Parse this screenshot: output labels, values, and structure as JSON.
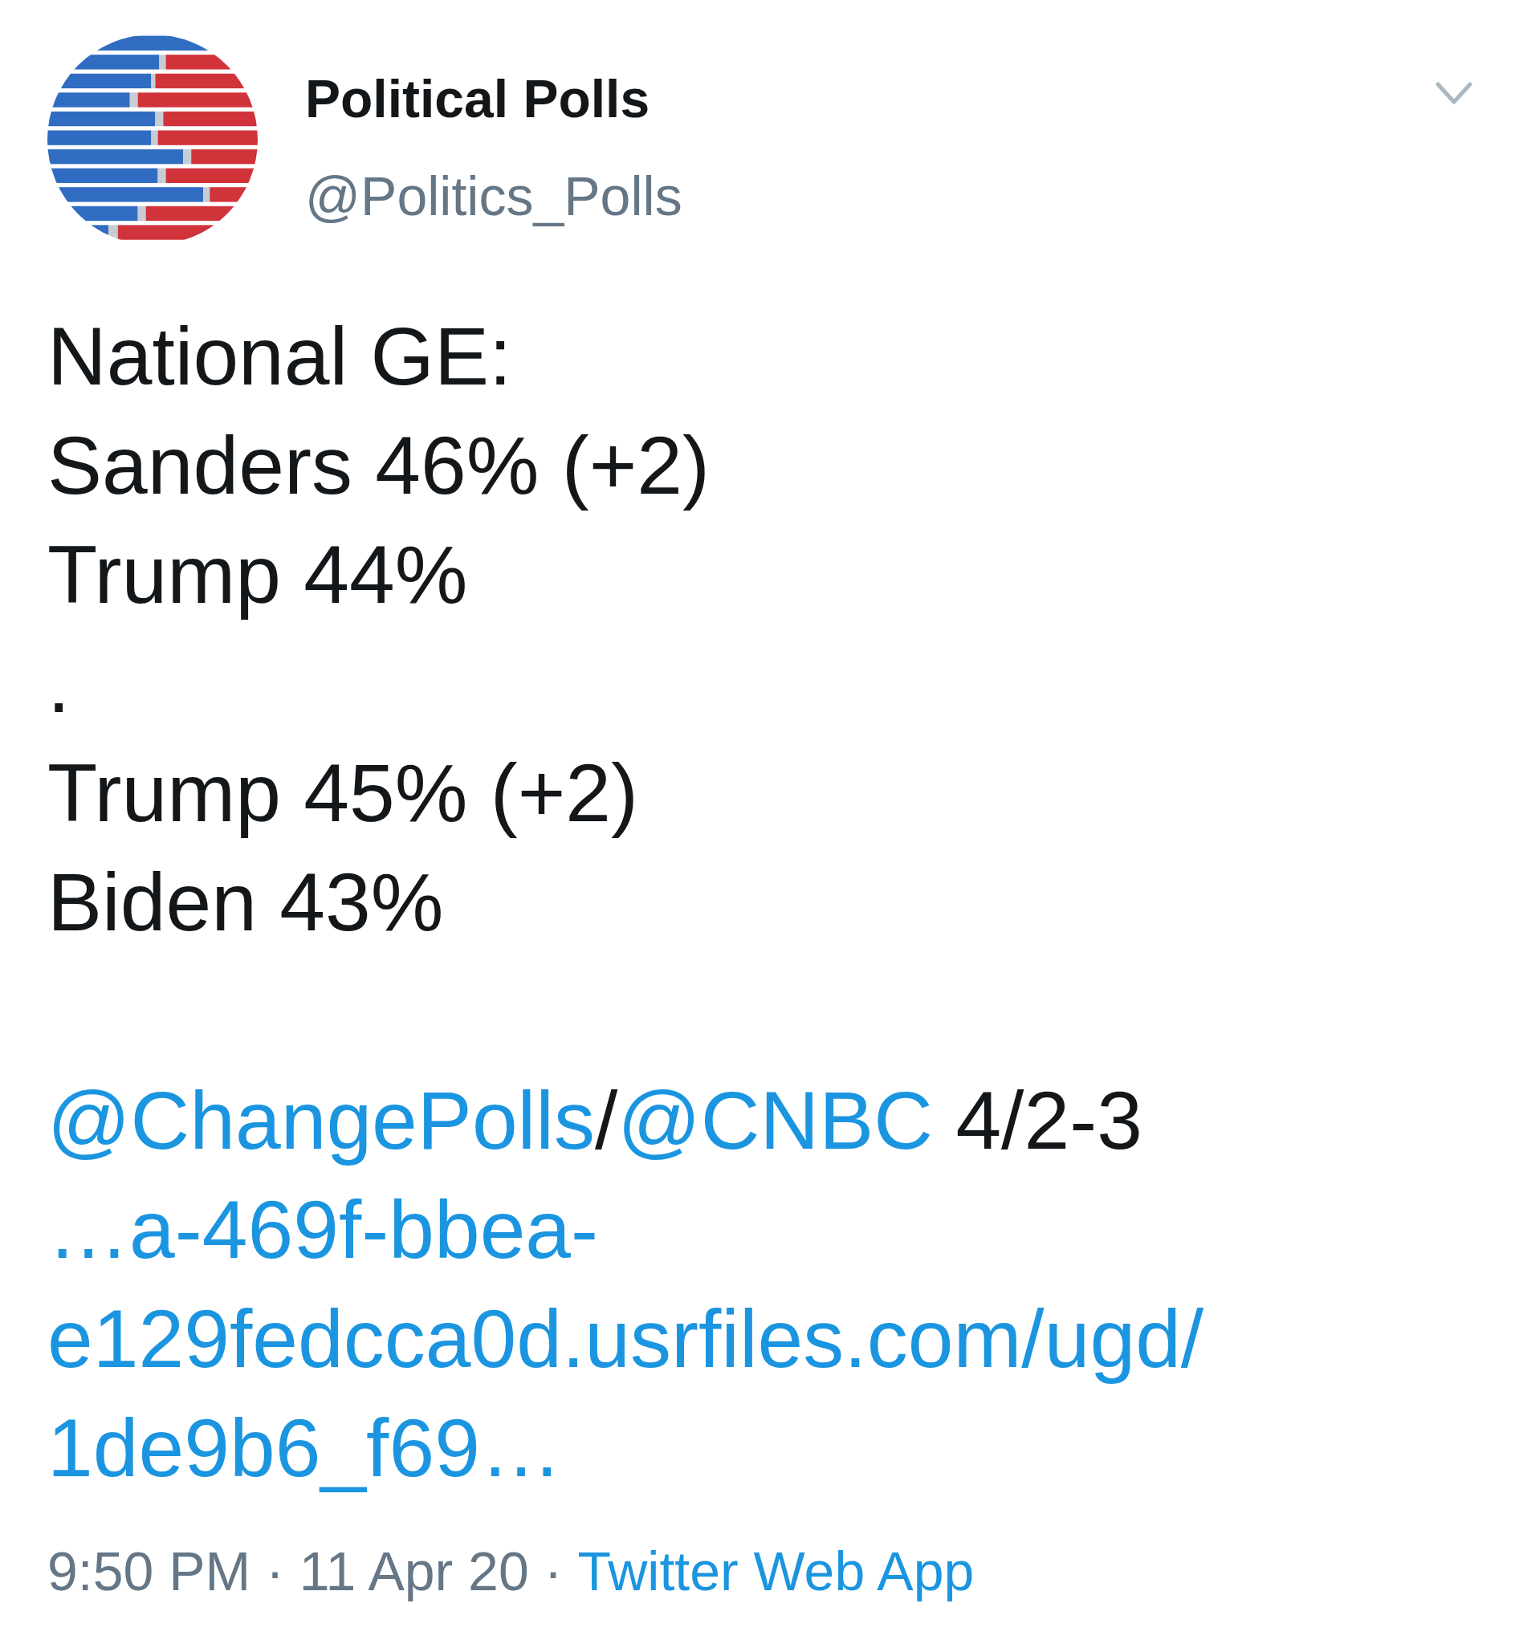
{
  "tweet": {
    "author": {
      "name": "Political Polls",
      "handle": "@Politics_Polls"
    },
    "paragraphs": [
      {
        "lines": [
          {
            "parts": [
              {
                "kind": "text",
                "text": "National GE:"
              }
            ]
          },
          {
            "parts": [
              {
                "kind": "text",
                "text": "Sanders 46% (+2)"
              }
            ]
          },
          {
            "parts": [
              {
                "kind": "text",
                "text": "Trump 44%"
              }
            ]
          },
          {
            "parts": [
              {
                "kind": "text",
                "text": "."
              }
            ]
          },
          {
            "parts": [
              {
                "kind": "text",
                "text": "Trump 45% (+2)"
              }
            ]
          },
          {
            "parts": [
              {
                "kind": "text",
                "text": "Biden 43%"
              }
            ]
          }
        ]
      },
      {
        "lines": [
          {
            "parts": [
              {
                "kind": "mention",
                "text": "@ChangePolls"
              },
              {
                "kind": "text",
                "text": "/"
              },
              {
                "kind": "mention",
                "text": "@CNBC"
              },
              {
                "kind": "text",
                "text": "4/2-3",
                "space_before": true
              }
            ]
          },
          {
            "parts": [
              {
                "kind": "link",
                "text": "…a-469f-bbea-"
              }
            ]
          },
          {
            "parts": [
              {
                "kind": "link",
                "text": "e129fedcca0d.usrfiles.com/ugd/"
              }
            ]
          },
          {
            "parts": [
              {
                "kind": "link",
                "text": "1de9b6_f69…"
              }
            ]
          }
        ]
      }
    ],
    "meta": {
      "time_date": "9:50 PM · 11 Apr 20",
      "separator": "·",
      "source": "Twitter Web App"
    }
  }
}
